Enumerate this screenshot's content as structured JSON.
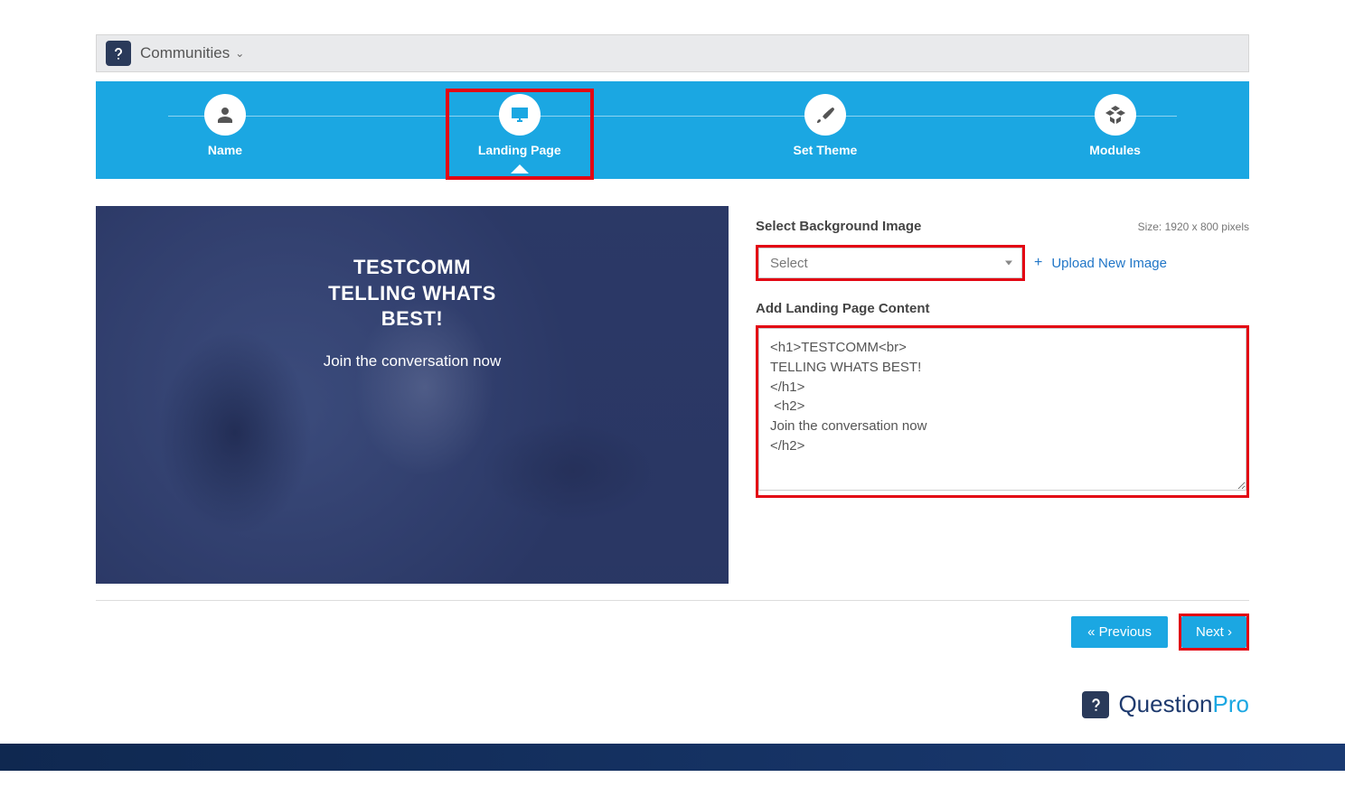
{
  "topbar": {
    "menu_label": "Communities"
  },
  "wizard": {
    "steps": [
      {
        "label": "Name"
      },
      {
        "label": "Landing Page"
      },
      {
        "label": "Set Theme"
      },
      {
        "label": "Modules"
      }
    ]
  },
  "preview": {
    "heading": "TESTCOMM\nTELLING WHATS\nBEST!",
    "subheading": "Join the conversation now"
  },
  "controls": {
    "bg_label": "Select Background Image",
    "bg_hint": "Size: 1920 x 800 pixels",
    "select_placeholder": "Select",
    "upload_label": "Upload New Image",
    "content_label": "Add Landing Page Content",
    "content_value": "<h1>TESTCOMM<br>\nTELLING WHATS BEST!\n</h1>\n <h2>\nJoin the conversation now\n</h2>"
  },
  "footer": {
    "prev_label": "«  Previous",
    "next_label": "Next ›"
  },
  "brand": {
    "name_a": "Question",
    "name_b": "Pro"
  }
}
